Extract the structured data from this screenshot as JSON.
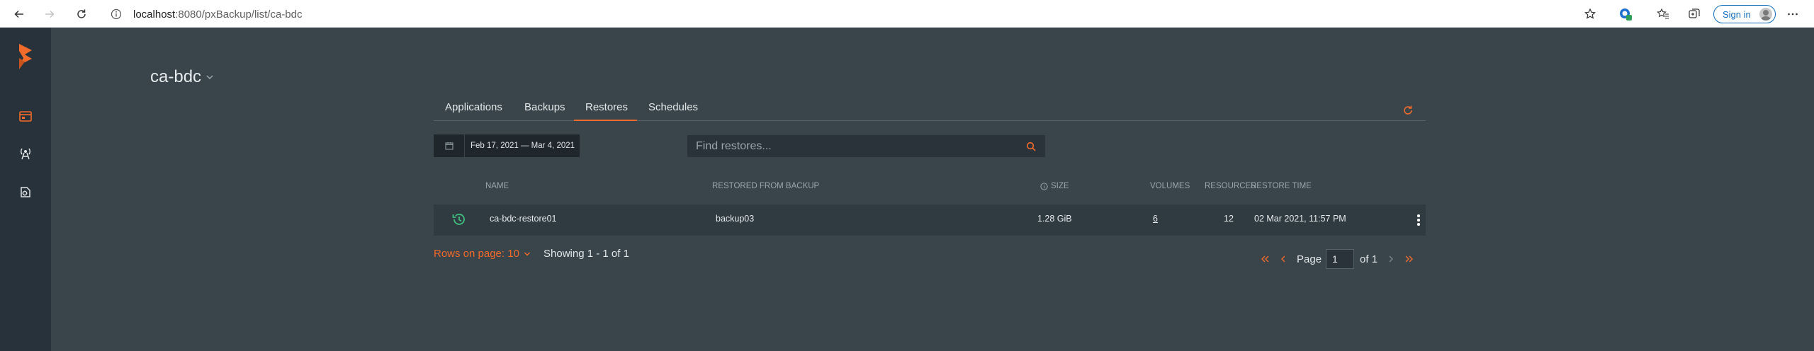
{
  "browser": {
    "url_host": "localhost",
    "url_rest": ":8080/pxBackup/list/ca-bdc",
    "sign_in_label": "Sign in",
    "badge_count": "1"
  },
  "sidebar": {
    "items": [
      {
        "name": "backups-icon",
        "active": true
      },
      {
        "name": "cloud-settings-icon",
        "active": false
      },
      {
        "name": "policies-icon",
        "active": false
      }
    ]
  },
  "header": {
    "cluster_name": "ca-bdc"
  },
  "tabs": [
    {
      "label": "Applications",
      "active": false
    },
    {
      "label": "Backups",
      "active": false
    },
    {
      "label": "Restores",
      "active": true
    },
    {
      "label": "Schedules",
      "active": false
    }
  ],
  "filters": {
    "date_range": "Feb 17, 2021  —  Mar 4, 2021",
    "search_placeholder": "Find restores..."
  },
  "table": {
    "columns": [
      "NAME",
      "RESTORED FROM BACKUP",
      "SIZE",
      "VOLUMES",
      "RESOURCES",
      "RESTORE TIME"
    ],
    "rows": [
      {
        "name": "ca-bdc-restore01",
        "backup": "backup03",
        "size": "1.28 GiB",
        "volumes": "6",
        "resources": "12",
        "restore_time": "02 Mar 2021, 11:57 PM"
      }
    ]
  },
  "pagination": {
    "rows_per_page": "Rows on page: 10",
    "showing": "Showing 1 - 1 of 1",
    "page_label": "Page",
    "page_value": "1",
    "of_label": "of 1"
  },
  "colors": {
    "accent": "#f26b2a",
    "sidebar": "#28323a",
    "main": "#3a444b",
    "success": "#3fbf7f"
  }
}
